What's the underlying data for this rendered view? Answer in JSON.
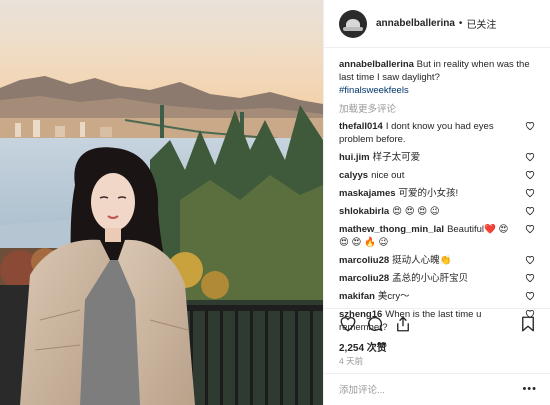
{
  "post": {
    "username": "annabelballerina",
    "separator": "•",
    "follow_label": "已关注",
    "caption_username": "annabelballerina",
    "caption_text": "But in reality when was the last time I saw daylight?",
    "hashtag": "#finalsweekfeels",
    "load_more": "加载更多评论",
    "comments": [
      {
        "user": "thefall014",
        "text": "I dont know you had eyes problem before."
      },
      {
        "user": "hui.jim",
        "text": "样子太可爱"
      },
      {
        "user": "calyys",
        "text": "nice out"
      },
      {
        "user": "maskajames",
        "text": "可爱的小女孩!"
      },
      {
        "user": "shlokabirla",
        "text": "😍 😍 😍 😉"
      },
      {
        "user": "mathew_thong_min_lal",
        "text": "Beautiful❤️ 😍 😍 😍 🔥 😉"
      },
      {
        "user": "marcoliu28",
        "text": "挺动人心魄👏"
      },
      {
        "user": "marcoliu28",
        "text": "孟总的小心肝宝贝"
      },
      {
        "user": "makifan",
        "text": "美cry～"
      },
      {
        "user": "szheng16",
        "text": "When is the last time u remember?"
      }
    ],
    "likes": "2,254 次赞",
    "time": "4 天前",
    "comment_placeholder": "添加评论...",
    "more_label": "•••"
  },
  "icons": {
    "like": "heart-icon",
    "comment": "comment-icon",
    "share": "share-icon",
    "save": "bookmark-icon",
    "comment_like": "heart-icon"
  },
  "colors": {
    "link": "#003569",
    "muted": "#999999",
    "text": "#262626",
    "divider": "#efefef"
  }
}
